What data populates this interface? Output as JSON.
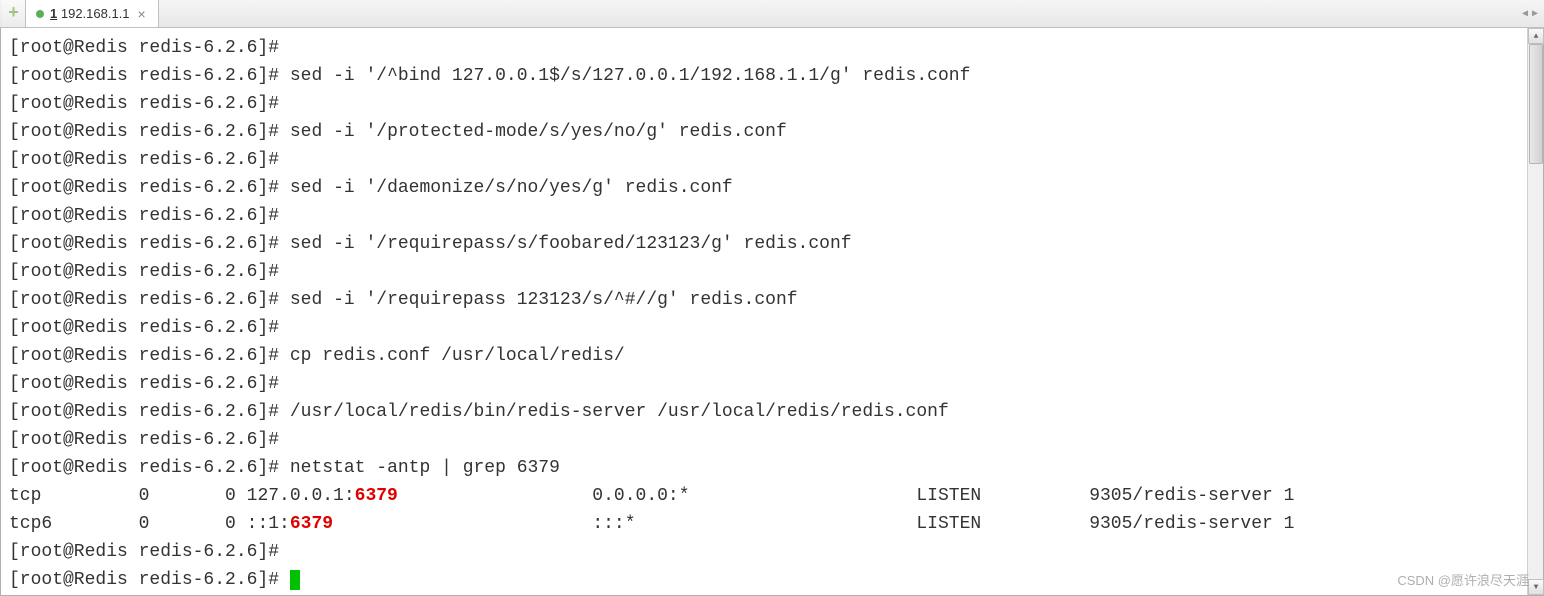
{
  "tabbar": {
    "add_label": "+",
    "tab_number": "1",
    "tab_title": "192.168.1.1",
    "close_label": "×",
    "nav_left": "◀",
    "nav_right": "▶"
  },
  "terminal": {
    "prompt": "[root@Redis redis-6.2.6]# ",
    "lines": [
      {
        "cmd": ""
      },
      {
        "cmd": "sed -i '/^bind 127.0.0.1$/s/127.0.0.1/192.168.1.1/g' redis.conf"
      },
      {
        "cmd": ""
      },
      {
        "cmd": "sed -i '/protected-mode/s/yes/no/g' redis.conf"
      },
      {
        "cmd": ""
      },
      {
        "cmd": "sed -i '/daemonize/s/no/yes/g' redis.conf"
      },
      {
        "cmd": ""
      },
      {
        "cmd": "sed -i '/requirepass/s/foobared/123123/g' redis.conf"
      },
      {
        "cmd": ""
      },
      {
        "cmd": "sed -i '/requirepass 123123/s/^#//g' redis.conf"
      },
      {
        "cmd": ""
      },
      {
        "cmd": "cp redis.conf /usr/local/redis/"
      },
      {
        "cmd": ""
      },
      {
        "cmd": "/usr/local/redis/bin/redis-server /usr/local/redis/redis.conf"
      },
      {
        "cmd": ""
      },
      {
        "cmd": "netstat -antp | grep 6379"
      }
    ],
    "netstat": [
      {
        "proto": "tcp",
        "recvq": "0",
        "sendq": "0",
        "local_pre": "127.0.0.1:",
        "local_port": "6379",
        "foreign": "0.0.0.0:*",
        "state": "LISTEN",
        "pid": "9305/redis-server 1"
      },
      {
        "proto": "tcp6",
        "recvq": "0",
        "sendq": "0",
        "local_pre": "::1:",
        "local_port": "6379",
        "foreign": ":::*",
        "state": "LISTEN",
        "pid": "9305/redis-server 1"
      }
    ],
    "trailing_prompts": 2
  },
  "watermark": "CSDN @愿许浪尽天涯"
}
